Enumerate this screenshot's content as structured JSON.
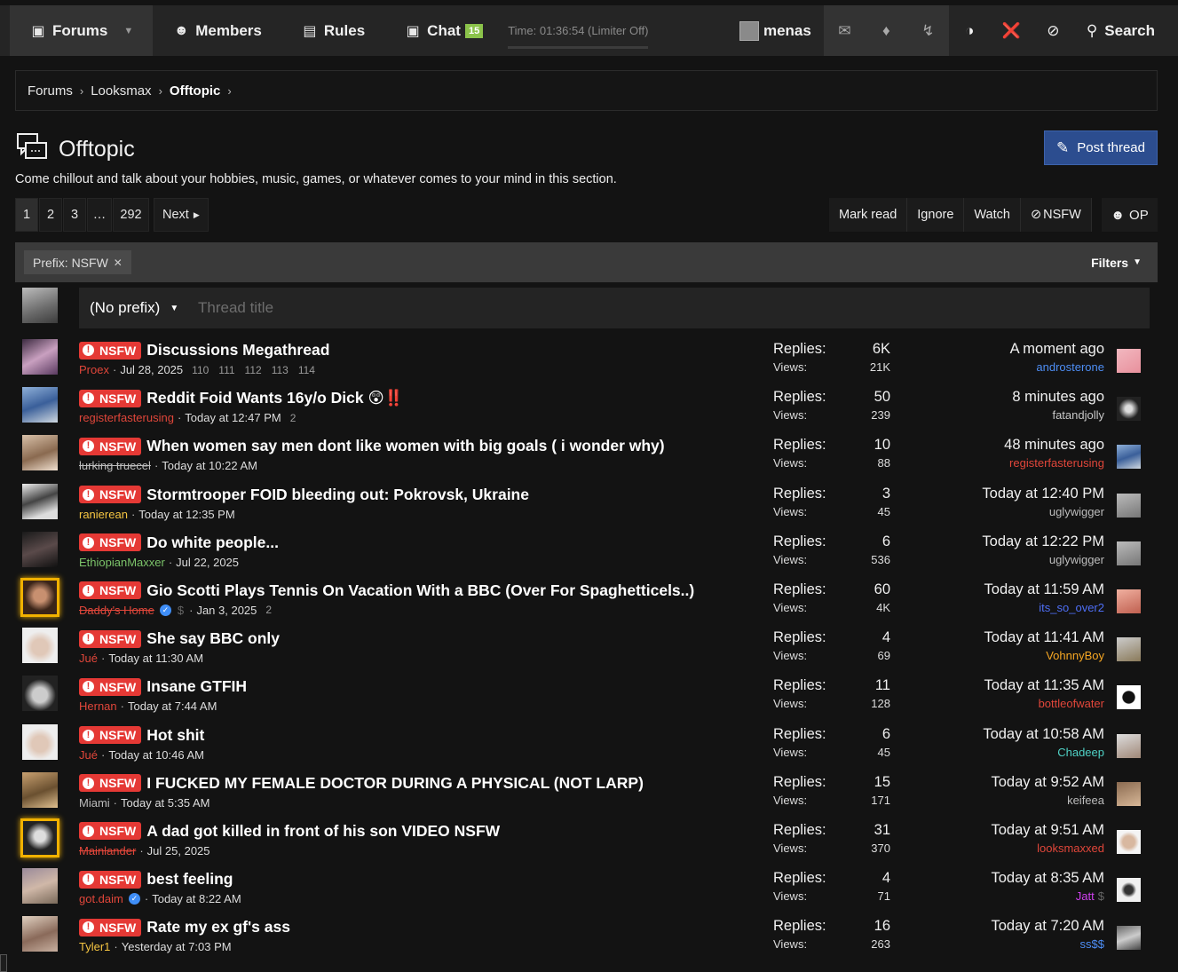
{
  "nav": {
    "forums": "Forums",
    "members": "Members",
    "rules": "Rules",
    "chat": "Chat",
    "chat_count": "15",
    "time": "Time: 01:36:54 (Limiter Off)",
    "username": "menas",
    "search": "Search"
  },
  "breadcrumb": [
    "Forums",
    "Looksmax",
    "Offtopic"
  ],
  "page": {
    "title": "Offtopic",
    "description": "Come chillout and talk about your hobbies, music, games, or whatever comes to your mind in this section.",
    "post_thread": "Post thread"
  },
  "pagination": {
    "pages": [
      "1",
      "2",
      "3",
      "…",
      "292"
    ],
    "next": "Next"
  },
  "actions": [
    "Mark read",
    "Ignore",
    "Watch",
    "NSFW"
  ],
  "op_label": "OP",
  "filter": {
    "prefix_chip": "Prefix: NSFW",
    "filters": "Filters"
  },
  "quick_thread": {
    "prefix": "(No prefix)",
    "placeholder": "Thread title"
  },
  "labels": {
    "badge": "NSFW",
    "replies": "Replies:",
    "views": "Views:"
  },
  "colors": {
    "badge": "#e53935",
    "post_button": "#2c4d8f",
    "chat_badge": "#8bc34a"
  },
  "threads": [
    {
      "title": "Discussions Megathread",
      "author": "Proex",
      "author_color": "#e0463a",
      "date": "Jul 28, 2025",
      "pages": [
        "110",
        "111",
        "112",
        "113",
        "114"
      ],
      "replies": "6K",
      "views": "21K",
      "last_time": "A moment ago",
      "last_user": "androsterone",
      "last_color": "#4e8ef5",
      "gold": false,
      "verified": false,
      "dollar": false,
      "av": "linear-gradient(150deg,#3c2a40,#c9a0c0 50%,#5a3a60)",
      "lav": "linear-gradient(150deg,#f2b8c0,#e8909c)"
    },
    {
      "title": "Reddit Foid Wants 16y/o Dick 😲‼️",
      "author": "registerfasterusing",
      "author_color": "#e0463a",
      "date": "Today at 12:47 PM",
      "pages": [
        "2"
      ],
      "replies": "50",
      "views": "239",
      "last_time": "8 minutes ago",
      "last_user": "fatandjolly",
      "last_color": "#c8c8c8",
      "gold": false,
      "verified": false,
      "dollar": false,
      "av": "linear-gradient(160deg,#8fb0d8,#3a5f9a 50%,#cfd8e0)",
      "lav": "radial-gradient(circle,#ddd 20%,#222 60%)"
    },
    {
      "title": "When women say men dont like women with big goals ( i wonder why)",
      "author": "lurking truecel",
      "author_color": "#bdbdbd",
      "strike": true,
      "date": "Today at 10:22 AM",
      "pages": [],
      "replies": "10",
      "views": "88",
      "last_time": "48 minutes ago",
      "last_user": "registerfasterusing",
      "last_color": "#e0463a",
      "gold": false,
      "verified": false,
      "dollar": false,
      "av": "linear-gradient(160deg,#d8c0a8,#8a6a50 55%,#f0e0d0)",
      "lav": "linear-gradient(160deg,#8fb0d8,#3a5f9a 50%,#cfd8e0)"
    },
    {
      "title": "Stormtrooper FOID bleeding out: Pokrovsk, Ukraine",
      "author": "ranierean",
      "author_color": "#f5c542",
      "date": "Today at 12:35 PM",
      "pages": [],
      "replies": "3",
      "views": "45",
      "last_time": "Today at 12:40 PM",
      "last_user": "uglywigger",
      "last_color": "#bdbdbd",
      "gold": false,
      "verified": false,
      "dollar": false,
      "av": "linear-gradient(160deg,#eee,#444 45%,#ddd 80%)",
      "lav": "linear-gradient(160deg,#bbb,#777)"
    },
    {
      "title": "Do white people...",
      "author": "EthiopianMaxxer",
      "author_color": "#7cc46a",
      "date": "Jul 22, 2025",
      "pages": [],
      "replies": "6",
      "views": "536",
      "last_time": "Today at 12:22 PM",
      "last_user": "uglywigger",
      "last_color": "#bdbdbd",
      "gold": false,
      "verified": false,
      "dollar": false,
      "av": "linear-gradient(160deg,#1a1a1a,#5a4a4a 50%,#111)",
      "lav": "linear-gradient(160deg,#bbb,#777)"
    },
    {
      "title": "Gio Scotti Plays Tennis On Vacation With a BBC (Over For Spaghetticels..)",
      "author": "Daddy's Home",
      "author_color": "#e0463a",
      "strike": true,
      "date": "Jan 3, 2025",
      "pages": [
        "2"
      ],
      "replies": "60",
      "views": "4K",
      "last_time": "Today at 11:59 AM",
      "last_user": "its_so_over2",
      "last_color": "#4e6ef5",
      "gold": true,
      "verified": true,
      "dollar": true,
      "av": "radial-gradient(circle at 50% 45%,#c89070 25%,#3a2418 60%)",
      "lav": "linear-gradient(160deg,#f0b0a0,#c06050)"
    },
    {
      "title": "She say BBC only",
      "author": "Jué",
      "author_color": "#e0463a",
      "date": "Today at 11:30 AM",
      "pages": [],
      "replies": "4",
      "views": "69",
      "last_time": "Today at 11:41 AM",
      "last_user": "VohnnyBoy",
      "last_color": "#f5a623",
      "gold": false,
      "verified": false,
      "dollar": false,
      "av": "radial-gradient(circle at 50% 55%,#e0c8b8 30%,#eee 60%)",
      "lav": "linear-gradient(160deg,#ccc,#8a7a5a)"
    },
    {
      "title": "Insane GTFIH",
      "author": "Hernan",
      "author_color": "#e0463a",
      "date": "Today at 7:44 AM",
      "pages": [],
      "replies": "11",
      "views": "128",
      "last_time": "Today at 11:35 AM",
      "last_user": "bottleofwater",
      "last_color": "#e0463a",
      "gold": false,
      "verified": false,
      "dollar": false,
      "av": "radial-gradient(circle at 50% 55%,#ccc 28%,#222 60%)",
      "lav": "radial-gradient(circle,#111 35%,#fff 40%)"
    },
    {
      "title": "Hot shit",
      "author": "Jué",
      "author_color": "#e0463a",
      "date": "Today at 10:46 AM",
      "pages": [],
      "replies": "6",
      "views": "45",
      "last_time": "Today at 10:58 AM",
      "last_user": "Chadeep",
      "last_color": "#4fd1c5",
      "gold": false,
      "verified": false,
      "dollar": false,
      "av": "radial-gradient(circle at 50% 55%,#e0c8b8 30%,#eee 60%)",
      "lav": "linear-gradient(160deg,#ddd,#a08878)"
    },
    {
      "title": "I FUCKED MY FEMALE DOCTOR DURING A PHYSICAL (NOT LARP)",
      "author": "Miami",
      "author_color": "#bdbdbd",
      "date": "Today at 5:35 AM",
      "pages": [],
      "replies": "15",
      "views": "171",
      "last_time": "Today at 9:52 AM",
      "last_user": "keifeea",
      "last_color": "#bdbdbd",
      "gold": false,
      "verified": false,
      "dollar": false,
      "av": "linear-gradient(160deg,#c8a070,#6a5030 55%,#e0c090)",
      "lav": "linear-gradient(160deg,#8a6a50,#d8b898)"
    },
    {
      "title": "A dad got killed in front of his son VIDEO NSFW",
      "author": "Mainlander",
      "author_color": "#e0463a",
      "strike": true,
      "date": "Jul 25, 2025",
      "pages": [],
      "replies": "31",
      "views": "370",
      "last_time": "Today at 9:51 AM",
      "last_user": "looksmaxxed",
      "last_color": "#e0463a",
      "gold": true,
      "verified": false,
      "dollar": false,
      "av": "radial-gradient(circle at 50% 45%,#ddd 22%,#222 55%)",
      "lav": "radial-gradient(circle,#d8b8a0 35%,#f4f4f4 60%)"
    },
    {
      "title": "best feeling",
      "author": "got.daim",
      "author_color": "#e0463a",
      "date": "Today at 8:22 AM",
      "pages": [],
      "replies": "4",
      "views": "71",
      "last_time": "Today at 8:35 AM",
      "last_user": "Jatt",
      "last_color": "#d040f0",
      "gold": false,
      "verified": true,
      "dollar": false,
      "lastdollar": true,
      "av": "linear-gradient(160deg,#9a8a9a,#d0b8a8 50%,#7a6a5a)",
      "lav": "radial-gradient(circle,#333 25%,#f0f0f0 45%)"
    },
    {
      "title": "Rate my ex gf's ass",
      "author": "Tyler1",
      "author_color": "#f5c542",
      "date": "Yesterday at 7:03 PM",
      "pages": [],
      "replies": "16",
      "views": "263",
      "last_time": "Today at 7:20 AM",
      "last_user": "ss$$",
      "last_color": "#4e8ef5",
      "gold": false,
      "verified": false,
      "dollar": false,
      "av": "linear-gradient(160deg,#e0d0c0,#8a6a5a 55%,#c8b0a0)",
      "lav": "linear-gradient(160deg,#666,#ccc 50%,#444)"
    }
  ]
}
